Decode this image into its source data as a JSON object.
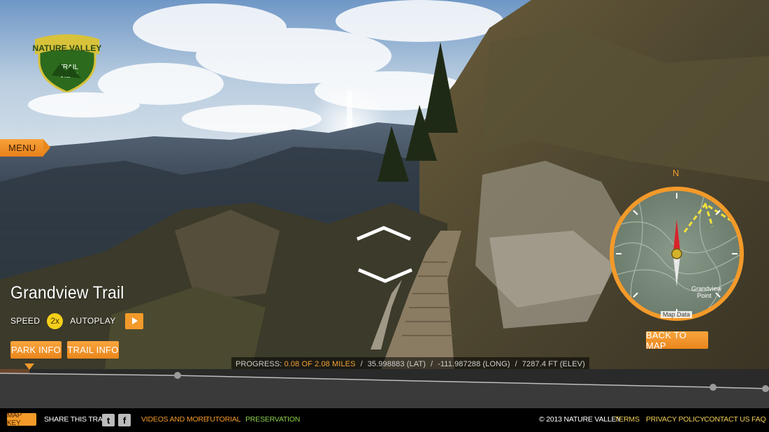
{
  "brand": {
    "logo_top": "NATURE VALLEY",
    "logo_bottom_1": "TRAIL",
    "logo_bottom_2": "VIEW"
  },
  "menu": {
    "label": "MENU"
  },
  "trail": {
    "name": "Grandview Trail"
  },
  "controls": {
    "speed_label": "SPEED",
    "speed_value": "2x",
    "autoplay_label": "AUTOPLAY"
  },
  "buttons": {
    "park_info": "PARK INFO",
    "trail_info": "TRAIL INFO",
    "back_to_map": "BACK TO MAP"
  },
  "compass": {
    "north": "N",
    "map_data": "Map Data",
    "place_label_1": "Grandview",
    "place_label_2": "Point"
  },
  "progress": {
    "label": "PROGRESS:",
    "distance": "0.08",
    "of": "OF",
    "total": "2.08 MILES",
    "lat": "35.998883 (LAT)",
    "long": "-111.987288 (LONG)",
    "elev": "7287.4 FT (ELEV)",
    "fraction": 0.038
  },
  "footer": {
    "map_key": "MAP KEY",
    "share": "SHARE THIS TRAIL",
    "videos": "VIDEOS AND MORE",
    "tutorial": "TUTORIAL",
    "preservation": "PRESERVATION",
    "copyright": "© 2013 NATURE VALLEY",
    "terms": "TERMS",
    "privacy": "PRIVACY POLICY",
    "contact": "CONTACT US",
    "faq": "FAQ"
  },
  "icons": {
    "twitter": "twitter-icon",
    "facebook": "facebook-icon",
    "nav_forward": "chevron-up-icon",
    "nav_back": "chevron-down-icon",
    "play": "play-icon"
  },
  "colors": {
    "accent": "#f39a2a",
    "speed_badge": "#f3cf1b",
    "preservation": "#8fd14f",
    "footer_bg": "#000000"
  }
}
